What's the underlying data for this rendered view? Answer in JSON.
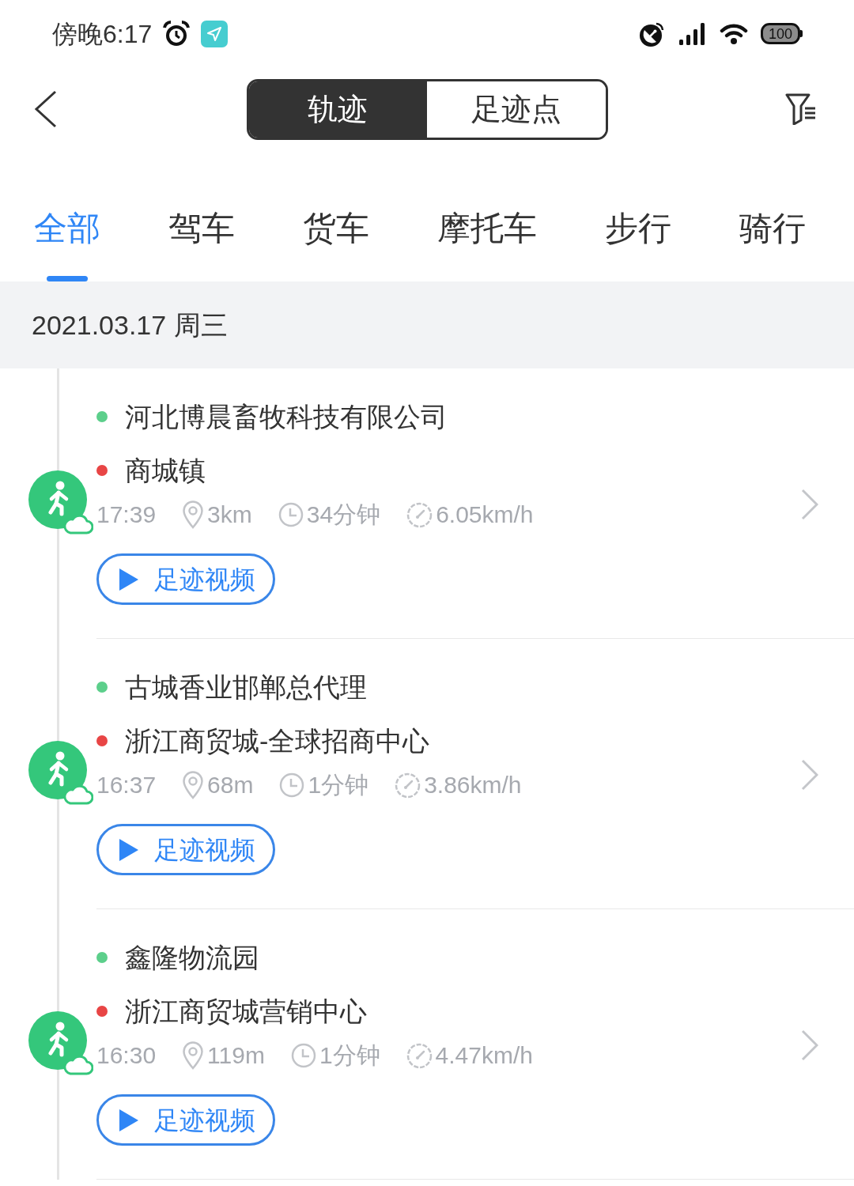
{
  "status_bar": {
    "time": "傍晚6:17",
    "battery": "100"
  },
  "header": {
    "segments": [
      {
        "label": "轨迹",
        "selected": true
      },
      {
        "label": "足迹点",
        "selected": false
      }
    ]
  },
  "categories": [
    {
      "label": "全部",
      "selected": true
    },
    {
      "label": "驾车",
      "selected": false
    },
    {
      "label": "货车",
      "selected": false
    },
    {
      "label": "摩托车",
      "selected": false
    },
    {
      "label": "步行",
      "selected": false
    },
    {
      "label": "骑行",
      "selected": false
    }
  ],
  "date_header": "2021.03.17 周三",
  "trips": [
    {
      "stops": [
        {
          "kind": "start",
          "name": "河北博晨畜牧科技有限公司"
        },
        {
          "kind": "end",
          "name": "商城镇"
        }
      ],
      "time": "17:39",
      "distance": "3km",
      "duration": "34分钟",
      "speed": "6.05km/h",
      "video_button": "足迹视频"
    },
    {
      "stops": [
        {
          "kind": "start",
          "name": "古城香业邯郸总代理"
        },
        {
          "kind": "end",
          "name": "浙江商贸城-全球招商中心"
        }
      ],
      "time": "16:37",
      "distance": "68m",
      "duration": "1分钟",
      "speed": "3.86km/h",
      "video_button": "足迹视频"
    },
    {
      "stops": [
        {
          "kind": "start",
          "name": "鑫隆物流园"
        },
        {
          "kind": "end",
          "name": "浙江商贸城营销中心"
        }
      ],
      "time": "16:30",
      "distance": "119m",
      "duration": "1分钟",
      "speed": "4.47km/h",
      "video_button": "足迹视频"
    }
  ]
}
